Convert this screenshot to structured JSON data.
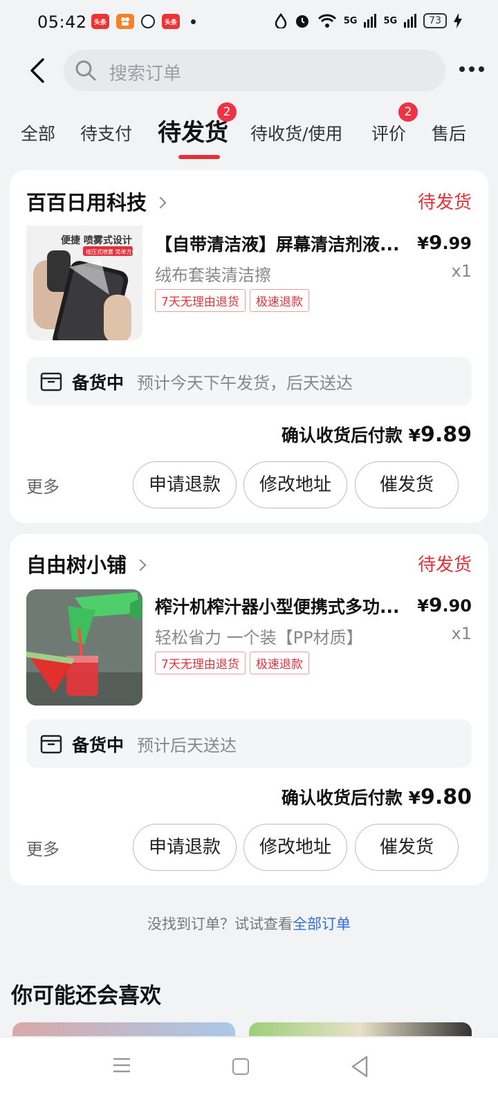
{
  "status_bar": {
    "time": "05:42",
    "battery": "73",
    "app1": "头条",
    "app2": "头条",
    "signal1": "5G",
    "signal2": "5G"
  },
  "search": {
    "placeholder": "搜索订单"
  },
  "tabs": [
    {
      "label": "全部"
    },
    {
      "label": "待支付"
    },
    {
      "label": "待发货",
      "badge": "2"
    },
    {
      "label": "待收货/使用"
    },
    {
      "label": "评价",
      "badge": "2"
    },
    {
      "label": "售后"
    }
  ],
  "orders": [
    {
      "shop": "百百日用科技",
      "status": "待发货",
      "product_title": "【自带清洁液】屏幕清洁剂液...",
      "price_symbol": "¥",
      "price_int": "9",
      "price_dec": ".99",
      "spec": "绒布套装清洁擦",
      "qty": "x1",
      "tags": [
        "7天无理由退货",
        "极速退款"
      ],
      "image_text": "便捷 喷雾式设计",
      "image_subtext": "按压式喷雾 简单方便",
      "ship_status": "备货中",
      "ship_estimate": "预计今天下午发货，后天送达",
      "pay_label": "确认收货后付款",
      "pay_symbol": "¥",
      "pay_amount": "9.89",
      "more": "更多",
      "buttons": [
        "申请退款",
        "修改地址",
        "催发货"
      ]
    },
    {
      "shop": "自由树小铺",
      "status": "待发货",
      "product_title": "榨汁机榨汁器小型便携式多功...",
      "price_symbol": "¥",
      "price_int": "9",
      "price_dec": ".90",
      "spec": "轻松省力  一个装【PP材质】",
      "qty": "x1",
      "tags": [
        "7天无理由退货",
        "极速退款"
      ],
      "ship_status": "备货中",
      "ship_estimate": "预计后天送达",
      "pay_label": "确认收货后付款",
      "pay_symbol": "¥",
      "pay_amount": "9.80",
      "more": "更多",
      "buttons": [
        "申请退款",
        "修改地址",
        "催发货"
      ]
    }
  ],
  "not_found": {
    "text": "没找到订单？试试查看",
    "link": "全部订单"
  },
  "recommend": {
    "title": "你可能还会喜欢"
  },
  "colors": {
    "accent": "#e5303a",
    "link": "#2f6fd8",
    "background": "#f2f3f5"
  }
}
